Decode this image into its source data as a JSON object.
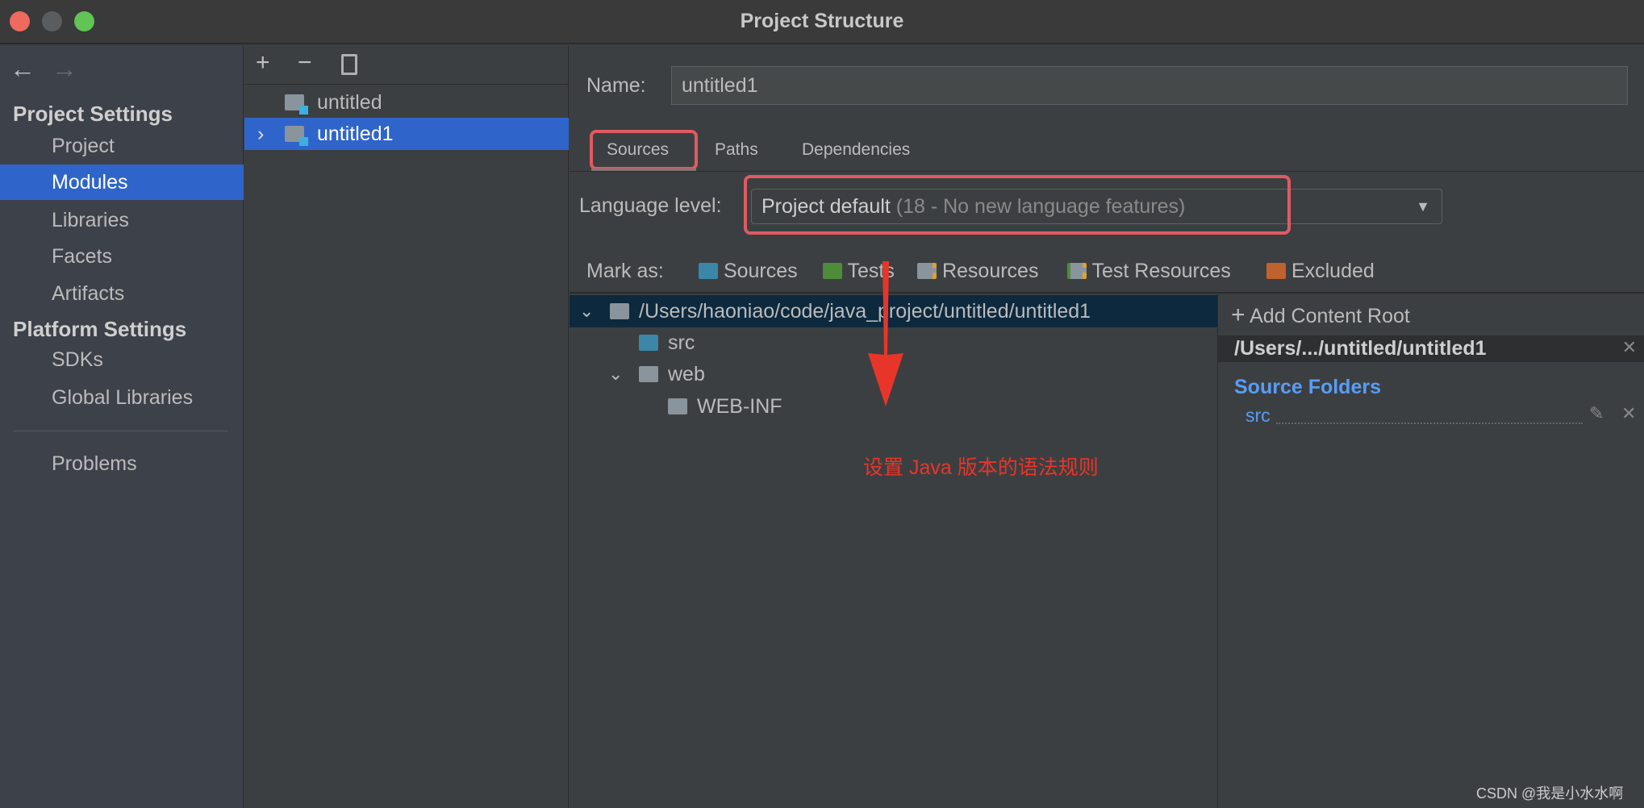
{
  "window": {
    "title": "Project Structure"
  },
  "sidebar": {
    "back_icon": "arrow-left-icon",
    "forward_icon": "arrow-right-icon",
    "project_settings_heading": "Project Settings",
    "project_items": [
      {
        "label": "Project"
      },
      {
        "label": "Modules",
        "selected": true
      },
      {
        "label": "Libraries"
      },
      {
        "label": "Facets"
      },
      {
        "label": "Artifacts"
      }
    ],
    "platform_settings_heading": "Platform Settings",
    "platform_items": [
      {
        "label": "SDKs"
      },
      {
        "label": "Global Libraries"
      }
    ],
    "problems": "Problems"
  },
  "modules": {
    "toolbar": {
      "add": "+",
      "remove": "−",
      "copy_icon": "copy-icon"
    },
    "items": [
      {
        "label": "untitled"
      },
      {
        "label": "untitled1",
        "selected": true
      }
    ]
  },
  "main": {
    "name_label": "Name:",
    "name_value": "untitled1",
    "tabs": [
      {
        "label": "Sources",
        "active": true
      },
      {
        "label": "Paths"
      },
      {
        "label": "Dependencies"
      }
    ],
    "language_level_label": "Language level:",
    "language_level_value": "Project default",
    "language_level_hint": "(18 - No new language features)",
    "mark_as_label": "Mark as:",
    "mark_as": [
      {
        "label": "Sources",
        "color": "#3b87a8"
      },
      {
        "label": "Tests",
        "color": "#4e8c3a"
      },
      {
        "label": "Resources",
        "color": "#8a949c"
      },
      {
        "label": "Test Resources",
        "color": "#8a949c"
      },
      {
        "label": "Excluded",
        "color": "#c0622d"
      }
    ],
    "tree": [
      {
        "label": "/Users/haoniao/code/java_project/untitled/untitled1"
      },
      {
        "label": "src"
      },
      {
        "label": "web"
      },
      {
        "label": "WEB-INF"
      }
    ],
    "content_root": {
      "add_label": "Add Content Root",
      "path": "/Users/.../untitled/untitled1",
      "source_folders_heading": "Source Folders",
      "source_folder": "src"
    }
  },
  "annotation": {
    "text": "设置 Java 版本的语法规则",
    "color": "#e8352a"
  },
  "watermark": "CSDN @我是小水水啊",
  "colors": {
    "accent": "#2f65ca",
    "highlight": "#e05a63",
    "link": "#589df6"
  }
}
